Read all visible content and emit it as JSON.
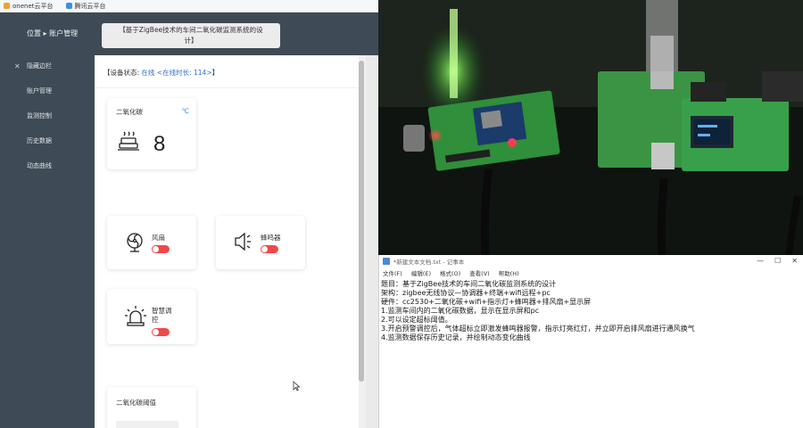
{
  "browser": {
    "bookmarks": [
      "onenet云平台",
      "腾讯云平台"
    ]
  },
  "sidebar": {
    "header": "位置 ▸ 账户管理",
    "items": [
      {
        "label": "隐藏边栏"
      },
      {
        "label": "账户管理"
      },
      {
        "label": "监测控制"
      },
      {
        "label": "历史数据"
      },
      {
        "label": "动态曲线"
      }
    ]
  },
  "header": {
    "title_line1": "【基于ZigBee技术的车间二氧化碳监测系统的设",
    "title_line2": "计】"
  },
  "status": {
    "prefix": "【设备状态: ",
    "online": "在线",
    "time_text": " <在线时长: 114>",
    "suffix": "】"
  },
  "co2_card": {
    "label": "二氧化碳",
    "unit": "℃",
    "value": "8"
  },
  "devices": {
    "fan": {
      "label": "风扇",
      "on": false
    },
    "buzzer": {
      "label": "蜂鸣器",
      "on": false
    },
    "light": {
      "label_line1": "智慧调",
      "label_line2": "控",
      "on": false
    }
  },
  "threshold_card": {
    "label": "二氧化碳阈值"
  },
  "notepad": {
    "title": "*新建文本文档.txt - 记事本",
    "menu": [
      "文件(F)",
      "编辑(E)",
      "格式(O)",
      "查看(V)",
      "帮助(H)"
    ],
    "lines": [
      "题目：基于ZigBee技术的车间二氧化碳监测系统的设计",
      "架构：zigbee无线协议—协调器+终端+wifi远程+pc",
      "硬件：cc2530+二氧化碳+wifi+指示灯+蜂鸣器+排风扇+显示屏",
      "1.监测车间内的二氧化碳数据，显示在显示屏和pc",
      "2.可以设定超标阈值。",
      "3.开启预警调控后，气体超标立即激发蜂鸣器报警，指示灯亮红灯，并立即开启排风扇进行通风换气",
      "4.监测数据保存历史记录，并绘制动态变化曲线"
    ]
  },
  "colors": {
    "sidebar_bg": "#3e4a55",
    "toggle_off": "#f04848",
    "accent": "#2d6fd3"
  }
}
